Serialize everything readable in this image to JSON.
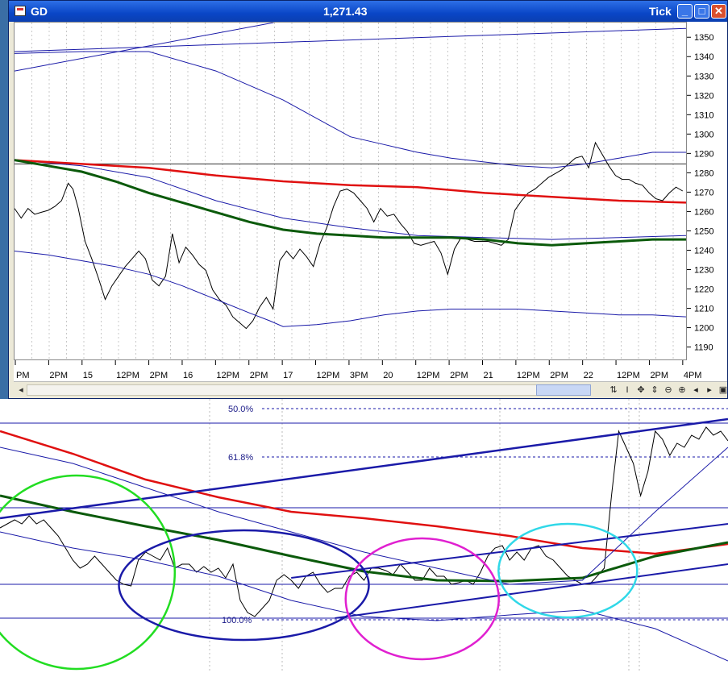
{
  "window": {
    "symbol": "GD",
    "last_price": "1,271.43",
    "interval": "Tick",
    "buttons": {
      "minimize": "_",
      "maximize": "□",
      "close": "✕"
    }
  },
  "colors": {
    "price": "#000000",
    "upper_band": "#1a1aa8",
    "ma_red": "#e01010",
    "ma_green": "#0b5a0b",
    "trendline": "#1a1aa8",
    "circle_green": "#22dd22",
    "circle_blue": "#1a1aa8",
    "circle_magenta": "#e020d0",
    "circle_cyan": "#30d8e8"
  },
  "toolbar": {
    "icons": [
      "refresh-icon",
      "cursor-icon",
      "move-icon",
      "pan-icon",
      "zoom-out-icon",
      "zoom-in-icon",
      "scroll-left-icon",
      "scroll-right-icon",
      "window-icon"
    ],
    "glyphs": [
      "⇅",
      "I",
      "✥",
      "⇕",
      "⊖",
      "⊕",
      "◂",
      "▸",
      "▣"
    ]
  },
  "chart_data": [
    {
      "type": "line",
      "yaxis_ticks": [
        1350,
        1340,
        1330,
        1320,
        1310,
        1300,
        1290,
        1280,
        1270,
        1260,
        1250,
        1240,
        1230,
        1220,
        1210,
        1200,
        1190
      ],
      "ylim": [
        1184,
        1358
      ],
      "time_labels": [
        "PM",
        "2PM",
        "15",
        "12PM",
        "2PM",
        "16",
        "12PM",
        "2PM",
        "17",
        "12PM",
        "3PM",
        "20",
        "12PM",
        "2PM",
        "21",
        "12PM",
        "2PM",
        "22",
        "12PM",
        "2PM",
        "4PM"
      ],
      "x_range": [
        0,
        100
      ],
      "reference_line": 1285,
      "series": [
        {
          "role": "price",
          "x": [
            0,
            1,
            2,
            3,
            4,
            5,
            6,
            7,
            8,
            8.7,
            9.5,
            10.5,
            11.5,
            12.5,
            13.5,
            14.5,
            15.5,
            16.5,
            17.5,
            18.5,
            19.5,
            20.5,
            21.5,
            22.5,
            23.5,
            24.5,
            25.5,
            26.5,
            27.5,
            28.5,
            29.5,
            30.5,
            31.5,
            32.5,
            33.5,
            34.5,
            35.5,
            36.5,
            37.5,
            38.5,
            39.5,
            40.5,
            41.5,
            42.5,
            43.5,
            44.5,
            45.5,
            46.5,
            47.5,
            48.5,
            49.5,
            50.5,
            51.5,
            52.5,
            53.5,
            54.5,
            55.5,
            56.5,
            57.5,
            58.5,
            59.5,
            60.5,
            61.5,
            62.5,
            63.5,
            64.5,
            65.5,
            66.5,
            67.5,
            68.5,
            69.5,
            70.5,
            71.5,
            72.5,
            73.5,
            74.5,
            75.5,
            76.5,
            77.5,
            78.5,
            79.5,
            80.5,
            81.5,
            82.5,
            83.5,
            84.5,
            85.5,
            86.5,
            87.5,
            88.5,
            89.5,
            90.5,
            91.5,
            92.5,
            93.5,
            94.5,
            95.5,
            96.5,
            97.5,
            98.5,
            99.5
          ],
          "values": [
            1262,
            1257,
            1262,
            1259,
            1260,
            1261,
            1263,
            1266,
            1275,
            1272,
            1262,
            1245,
            1236,
            1226,
            1215,
            1222,
            1227,
            1232,
            1236,
            1240,
            1236,
            1225,
            1222,
            1227,
            1249,
            1234,
            1242,
            1238,
            1233,
            1230,
            1220,
            1215,
            1212,
            1206,
            1203,
            1200,
            1204,
            1211,
            1216,
            1210,
            1235,
            1240,
            1236,
            1241,
            1237,
            1232,
            1244,
            1252,
            1263,
            1271,
            1272,
            1270,
            1266,
            1262,
            1255,
            1262,
            1258,
            1259,
            1254,
            1250,
            1244,
            1243,
            1244,
            1245,
            1239,
            1228,
            1241,
            1247,
            1246,
            1245,
            1245,
            1245,
            1244,
            1243,
            1246,
            1261,
            1266,
            1270,
            1272,
            1275,
            1278,
            1280,
            1282,
            1285,
            1288,
            1289,
            1283,
            1296,
            1290,
            1284,
            1279,
            1277,
            1277,
            1275,
            1274,
            1270,
            1267,
            1266,
            1270,
            1273,
            1271
          ]
        },
        {
          "role": "upper-band",
          "x": [
            0,
            10,
            20,
            30,
            40,
            50,
            55,
            60,
            65,
            70,
            75,
            80,
            85,
            90,
            95,
            100
          ],
          "values": [
            1342,
            1343,
            1343,
            1333,
            1318,
            1299,
            1295,
            1291,
            1288,
            1286,
            1284,
            1283,
            1285,
            1288,
            1291,
            1291
          ]
        },
        {
          "role": "lower-band",
          "x": [
            0,
            5,
            10,
            15,
            20,
            25,
            30,
            35,
            38,
            40,
            45,
            50,
            55,
            60,
            65,
            70,
            75,
            80,
            85,
            90,
            95,
            100
          ],
          "values": [
            1240,
            1238,
            1235,
            1232,
            1228,
            1222,
            1215,
            1208,
            1204,
            1201,
            1202,
            1204,
            1207,
            1209,
            1210,
            1210,
            1210,
            1209,
            1208,
            1207,
            1207,
            1206
          ]
        },
        {
          "role": "inner-band",
          "x": [
            0,
            10,
            20,
            30,
            40,
            50,
            60,
            70,
            80,
            90,
            100
          ],
          "values": [
            1287,
            1284,
            1278,
            1266,
            1257,
            1252,
            1248,
            1247,
            1246,
            1247,
            1248
          ]
        },
        {
          "role": "ma-red",
          "x": [
            0,
            10,
            20,
            30,
            40,
            50,
            60,
            70,
            80,
            90,
            100
          ],
          "values": [
            1287,
            1285,
            1283,
            1279,
            1276,
            1274,
            1273,
            1270,
            1268,
            1266,
            1265
          ]
        },
        {
          "role": "ma-green",
          "x": [
            0,
            5,
            10,
            15,
            20,
            25,
            30,
            35,
            40,
            45,
            50,
            55,
            60,
            65,
            70,
            75,
            80,
            85,
            90,
            95,
            100
          ],
          "values": [
            1287,
            1284,
            1281,
            1276,
            1270,
            1265,
            1260,
            1255,
            1251,
            1249,
            1248,
            1247,
            1247,
            1247,
            1246,
            1244,
            1243,
            1244,
            1245,
            1246,
            1246
          ]
        },
        {
          "role": "trendline-steep",
          "x": [
            0,
            38.6
          ],
          "values": [
            1333,
            1358
          ]
        },
        {
          "role": "trendline-flat",
          "x": [
            0,
            100
          ],
          "values": [
            1343,
            1355
          ]
        }
      ]
    },
    {
      "type": "line",
      "fib_levels": [
        {
          "label": "50.0%",
          "value": 0
        },
        {
          "label": "61.8%",
          "value": 60
        },
        {
          "label": "100.0%",
          "value": 262
        }
      ],
      "x_range": [
        0,
        100
      ],
      "ylim": [
        0,
        340
      ],
      "series": [
        {
          "role": "price",
          "x": [
            0,
            2,
            3,
            4,
            5,
            6,
            7,
            8,
            9,
            10,
            11,
            12,
            13,
            14,
            15,
            16,
            17,
            18,
            19,
            20,
            21,
            22,
            23,
            24,
            25,
            26,
            27,
            28,
            29,
            30,
            31,
            32,
            33,
            34,
            35,
            36,
            37,
            38,
            39,
            40,
            41,
            42,
            43,
            44,
            45,
            46,
            47,
            48,
            49,
            50,
            51,
            52,
            53,
            54,
            55,
            56,
            57,
            58,
            59,
            60,
            61,
            62,
            63,
            64,
            65,
            66,
            67,
            68,
            69,
            70,
            71,
            72,
            73,
            74,
            75,
            76,
            77,
            78,
            79,
            80,
            81,
            82,
            83,
            84,
            85,
            86,
            87,
            88,
            89,
            90,
            91,
            92,
            93,
            94,
            95,
            96,
            97,
            98,
            99,
            100
          ],
          "values": [
            160,
            150,
            155,
            145,
            155,
            150,
            160,
            170,
            185,
            200,
            210,
            205,
            195,
            205,
            215,
            225,
            230,
            232,
            200,
            190,
            195,
            200,
            185,
            210,
            205,
            205,
            215,
            208,
            215,
            210,
            222,
            205,
            250,
            265,
            270,
            260,
            250,
            225,
            218,
            225,
            235,
            220,
            215,
            230,
            240,
            235,
            235,
            220,
            215,
            225,
            210,
            210,
            213,
            218,
            205,
            215,
            225,
            225,
            210,
            220,
            220,
            230,
            228,
            225,
            230,
            215,
            195,
            185,
            182,
            200,
            190,
            200,
            185,
            182,
            195,
            200,
            210,
            220,
            225,
            230,
            230,
            220,
            210,
            120,
            40,
            60,
            80,
            120,
            90,
            40,
            50,
            70,
            55,
            60,
            45,
            50,
            35,
            45,
            40,
            52
          ]
        },
        {
          "role": "ma-red",
          "x": [
            0,
            10,
            20,
            30,
            40,
            50,
            60,
            70,
            80,
            90,
            100
          ],
          "values": [
            40,
            68,
            100,
            122,
            140,
            148,
            158,
            170,
            185,
            192,
            180
          ]
        },
        {
          "role": "ma-green",
          "x": [
            0,
            10,
            20,
            30,
            40,
            50,
            60,
            70,
            80,
            90,
            100
          ],
          "values": [
            120,
            140,
            158,
            175,
            195,
            214,
            225,
            226,
            222,
            195,
            178
          ]
        },
        {
          "role": "band-upper",
          "x": [
            0,
            10,
            20,
            30,
            40,
            50,
            60,
            70,
            80,
            90,
            100
          ],
          "values": [
            60,
            80,
            110,
            140,
            165,
            190,
            210,
            230,
            225,
            140,
            60
          ]
        },
        {
          "role": "band-lower",
          "x": [
            0,
            10,
            20,
            30,
            40,
            50,
            60,
            70,
            80,
            90,
            100
          ],
          "values": [
            165,
            185,
            200,
            220,
            250,
            270,
            275,
            268,
            262,
            285,
            325
          ]
        },
        {
          "role": "trendline-long",
          "x": [
            0,
            100
          ],
          "values": [
            148,
            25
          ]
        },
        {
          "role": "trendline-mid",
          "x": [
            40,
            100
          ],
          "values": [
            222,
            155
          ]
        },
        {
          "role": "trendline-low",
          "x": [
            46,
            100
          ],
          "values": [
            272,
            205
          ]
        }
      ],
      "annotations": [
        {
          "shape": "circle",
          "color": "circle_green",
          "cx": 10.5,
          "cy": 215
        },
        {
          "shape": "circle",
          "color": "circle_blue",
          "cx": 33.5,
          "cy": 231
        },
        {
          "shape": "circle",
          "color": "circle_magenta",
          "cx": 58,
          "cy": 248
        },
        {
          "shape": "circle",
          "color": "circle_cyan",
          "cx": 78,
          "cy": 213
        }
      ]
    }
  ]
}
